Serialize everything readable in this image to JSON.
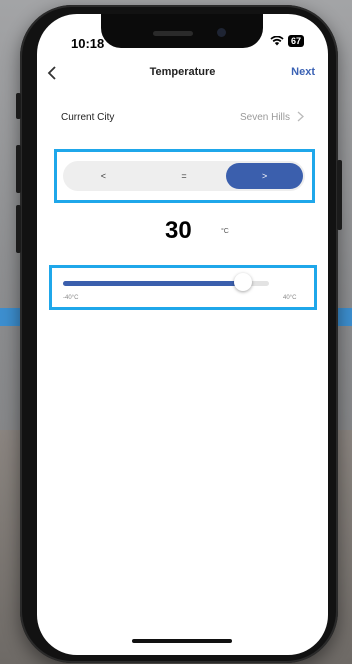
{
  "status_bar": {
    "time": "10:18",
    "wifi_icon": "wifi-icon",
    "battery": "67"
  },
  "nav": {
    "title": "Temperature",
    "next_label": "Next",
    "back_icon": "chevron-left-icon"
  },
  "city": {
    "label": "Current City",
    "value": "Seven Hills",
    "chevron_icon": "chevron-right-icon"
  },
  "comparison": {
    "options": [
      "<",
      "=",
      ">"
    ],
    "selected": ">"
  },
  "temperature": {
    "value": "30",
    "unit": "°C"
  },
  "slider": {
    "min_label": "-40°C",
    "max_label": "40°C",
    "min": -40,
    "max": 40,
    "value": 30
  },
  "colors": {
    "accent": "#3b5fad",
    "highlight": "#1fa7ea",
    "link": "#3b62b4"
  }
}
